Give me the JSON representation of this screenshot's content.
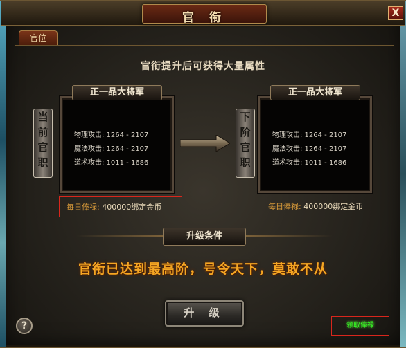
{
  "window": {
    "title": "官 衔",
    "close_label": "X"
  },
  "tabs": [
    {
      "label": "官位"
    }
  ],
  "subtitle": "官衔提升后可获得大量属性",
  "current": {
    "side_label": [
      "当",
      "前",
      "官",
      "职"
    ],
    "rank": "正一品大将军",
    "stats": [
      "物理攻击: 1264 - 2107",
      "魔法攻击: 1264 - 2107",
      "道术攻击: 1011 - 1686"
    ],
    "salary_label": "每日俸禄:",
    "salary_value": "400000绑定金币"
  },
  "next": {
    "side_label": [
      "下",
      "阶",
      "官",
      "职"
    ],
    "rank": "正一品大将军",
    "stats": [
      "物理攻击: 1264 - 2107",
      "魔法攻击: 1264 - 2107",
      "道术攻击: 1011 - 1686"
    ],
    "salary_label": "每日俸禄:",
    "salary_value": "400000绑定金币"
  },
  "condition_title": "升级条件",
  "max_message": "官衔已达到最高阶，号令天下，莫敢不从",
  "upgrade_button": "升 级",
  "help_label": "?",
  "green_label": "领取俸禄",
  "colors": {
    "accent_gold": "#f5a623",
    "green_text": "#33ff22",
    "highlight_red": "#d9261c"
  }
}
